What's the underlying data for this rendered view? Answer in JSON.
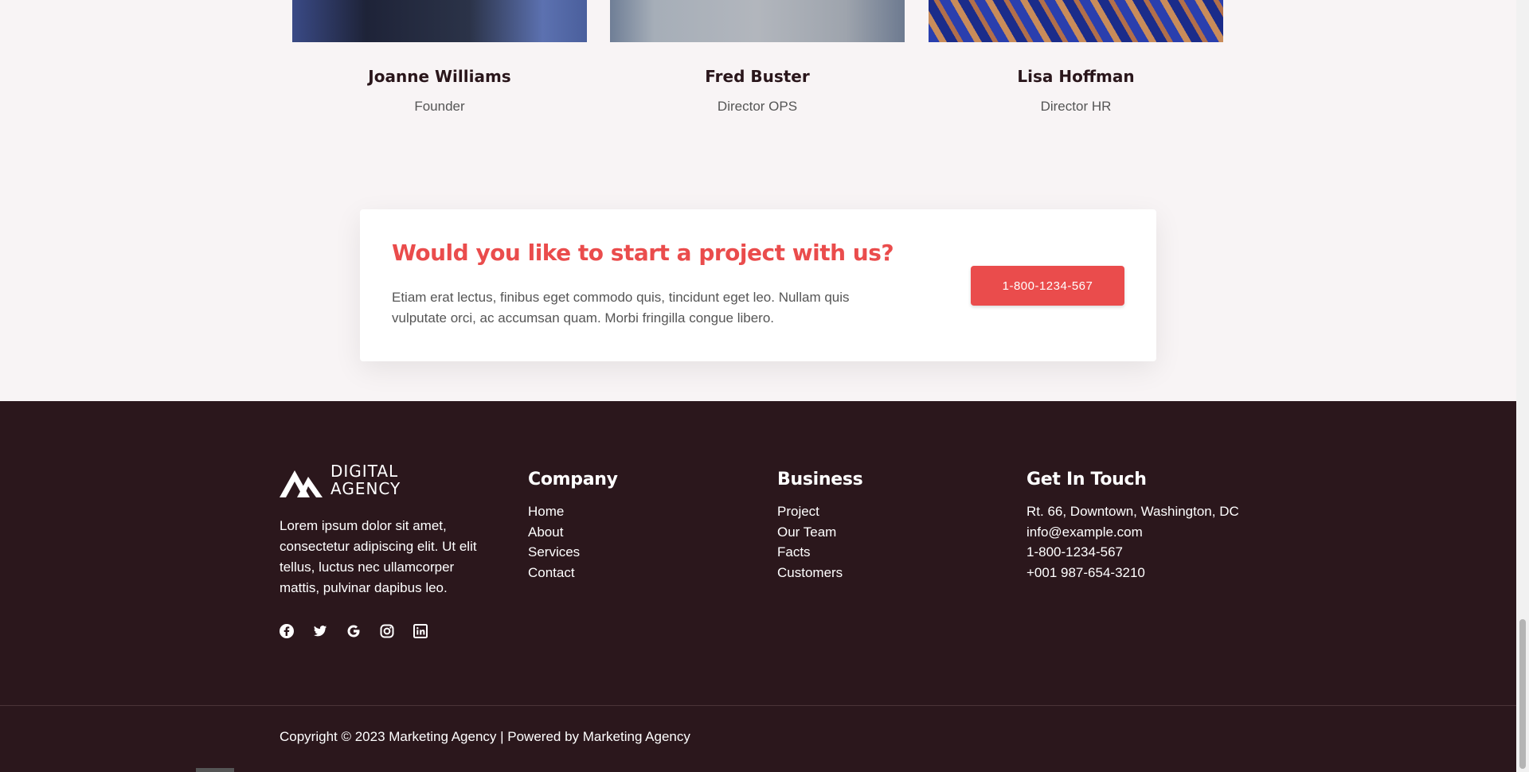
{
  "team": [
    {
      "name": "Joanne Williams",
      "role": "Founder"
    },
    {
      "name": "Fred Buster",
      "role": "Director OPS"
    },
    {
      "name": "Lisa Hoffman",
      "role": "Director HR"
    }
  ],
  "cta": {
    "title": "Would you like to start a project with us?",
    "text": "Etiam erat lectus, finibus eget commodo quis, tincidunt eget leo. Nullam quis vulputate orci, ac accumsan quam. Morbi fringilla congue libero.",
    "button": "1-800-1234-567"
  },
  "footer": {
    "brand_line1": "DIGITAL",
    "brand_line2": "AGENCY",
    "about": "Lorem ipsum dolor sit amet, consectetur adipiscing elit. Ut elit tellus, luctus nec ullamcorper mattis, pulvinar dapibus leo.",
    "social_icons": [
      "facebook-icon",
      "twitter-icon",
      "google-icon",
      "instagram-icon",
      "linkedin-icon"
    ],
    "company": {
      "heading": "Company",
      "links": [
        "Home",
        "About",
        "Services",
        "Contact"
      ]
    },
    "business": {
      "heading": "Business",
      "links": [
        "Project",
        "Our Team",
        "Facts",
        "Customers"
      ]
    },
    "contact": {
      "heading": "Get In Touch",
      "lines": [
        "Rt. 66, Downtown, Washington, DC",
        "info@example.com",
        "1-800-1234-567",
        "+001 987-654-3210"
      ]
    },
    "copyright": "Copyright © 2023 Marketing Agency | Powered by Marketing Agency"
  },
  "colors": {
    "accent": "#ea4c4c",
    "footer_bg": "#2b171c",
    "page_bg": "#f8f4f5"
  }
}
